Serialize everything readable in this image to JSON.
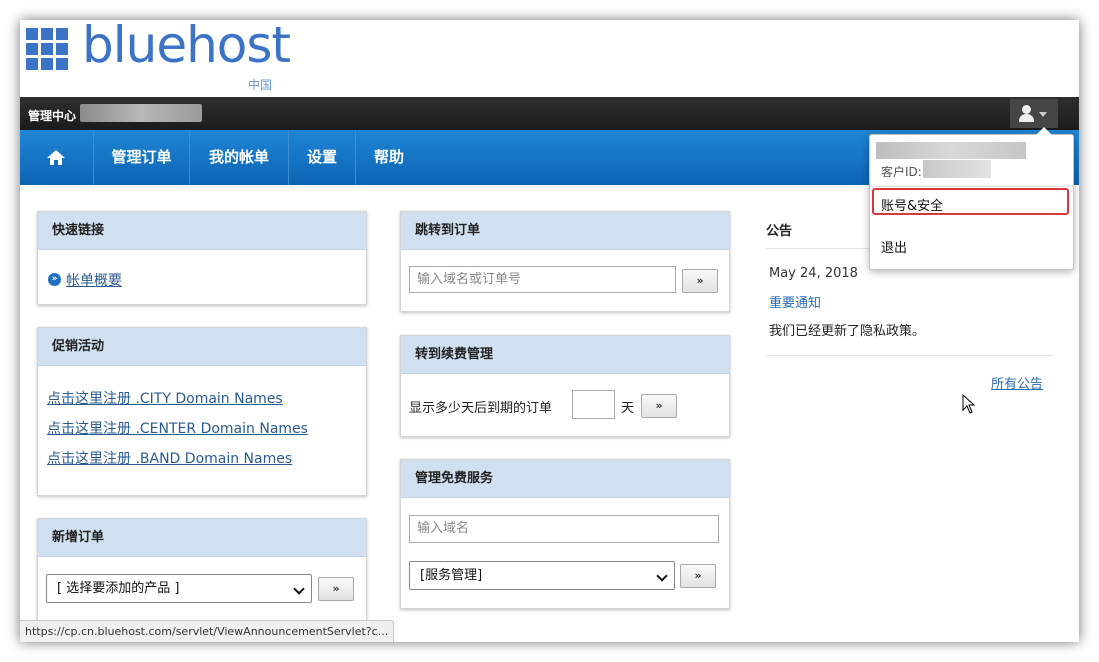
{
  "logo": {
    "text": "bluehost",
    "sub": "中国",
    "color": "#3b73c7"
  },
  "topbar": {
    "title": "管理中心",
    "user_icon": "user-icon"
  },
  "nav": {
    "home_icon": "home-icon",
    "items": [
      {
        "label": "管理订单"
      },
      {
        "label": "我的帐单"
      },
      {
        "label": "设置"
      },
      {
        "label": "帮助"
      }
    ],
    "color": "#1277c8"
  },
  "quick_links": {
    "title": "快速链接",
    "link": "帐单概要",
    "icon": "double-chevron-right-icon"
  },
  "promo": {
    "title": "促销活动",
    "links": [
      "点击这里注册 .CITY Domain Names",
      "点击这里注册 .CENTER Domain Names",
      "点击这里注册 .BAND Domain Names"
    ]
  },
  "new_order": {
    "title": "新增订单",
    "select_value": "[ 选择要添加的产品 ]",
    "go": "»"
  },
  "jump_order": {
    "title": "跳转到订单",
    "placeholder": "输入域名或订单号",
    "go": "»"
  },
  "renewal": {
    "title": "转到续费管理",
    "label": "显示多少天后到期的订单",
    "unit": "天",
    "go": "»"
  },
  "free_services": {
    "title": "管理免费服务",
    "placeholder": "输入域名",
    "select_value": "[服务管理]",
    "go": "»"
  },
  "announcements": {
    "title": "公告",
    "date": "May 24, 2018",
    "link": "重要通知",
    "text": "我们已经更新了隐私政策。",
    "all": "所有公告"
  },
  "user_menu": {
    "customer_id_label": "客户ID:",
    "items": [
      "账号&安全",
      "退出"
    ],
    "highlight_color": "#d9363e"
  },
  "status_bar": {
    "url": "https://cp.cn.bluehost.com/servlet/ViewAnnouncementServlet?c..."
  }
}
